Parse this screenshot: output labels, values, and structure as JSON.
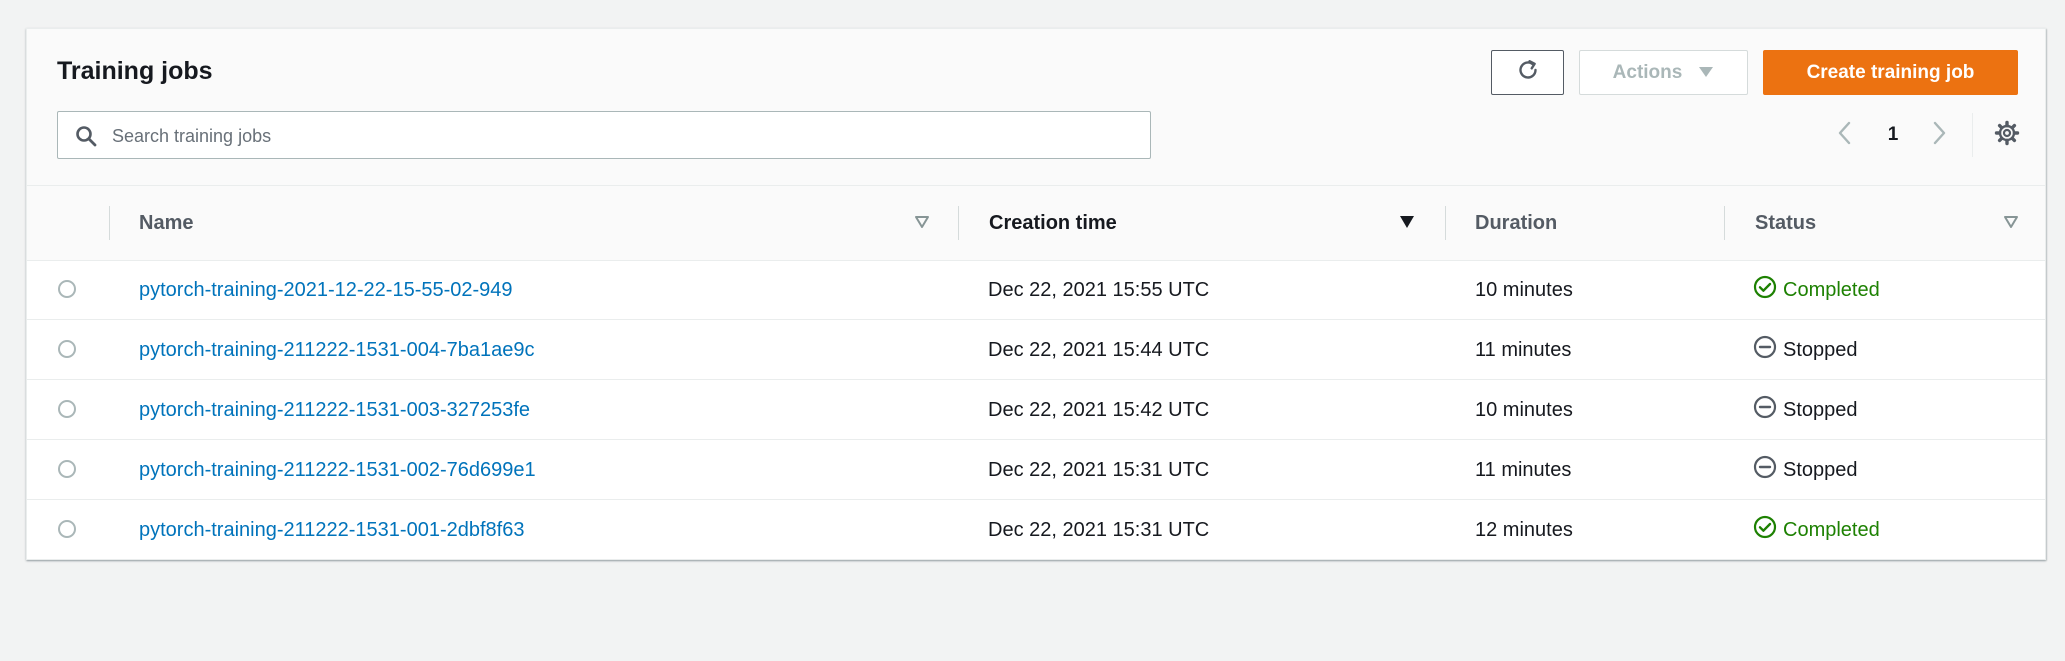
{
  "panel": {
    "title": "Training jobs",
    "search": {
      "placeholder": "Search training jobs",
      "value": ""
    },
    "toolbar": {
      "refresh_icon": "refresh-icon",
      "actions_label": "Actions",
      "create_label": "Create training job"
    },
    "pagination": {
      "current_page": "1"
    }
  },
  "table": {
    "columns": [
      {
        "label": "Name",
        "sort": "sortable"
      },
      {
        "label": "Creation time",
        "sort": "descending"
      },
      {
        "label": "Duration",
        "sort": "none"
      },
      {
        "label": "Status",
        "sort": "sortable"
      }
    ],
    "rows": [
      {
        "name": "pytorch-training-2021-12-22-15-55-02-949",
        "creation_time": "Dec 22, 2021 15:55 UTC",
        "duration": "10 minutes",
        "status": "Completed",
        "status_type": "completed"
      },
      {
        "name": "pytorch-training-211222-1531-004-7ba1ae9c",
        "creation_time": "Dec 22, 2021 15:44 UTC",
        "duration": "11 minutes",
        "status": "Stopped",
        "status_type": "stopped"
      },
      {
        "name": "pytorch-training-211222-1531-003-327253fe",
        "creation_time": "Dec 22, 2021 15:42 UTC",
        "duration": "10 minutes",
        "status": "Stopped",
        "status_type": "stopped"
      },
      {
        "name": "pytorch-training-211222-1531-002-76d699e1",
        "creation_time": "Dec 22, 2021 15:31 UTC",
        "duration": "11 minutes",
        "status": "Stopped",
        "status_type": "stopped"
      },
      {
        "name": "pytorch-training-211222-1531-001-2dbf8f63",
        "creation_time": "Dec 22, 2021 15:31 UTC",
        "duration": "12 minutes",
        "status": "Completed",
        "status_type": "completed"
      }
    ]
  },
  "colors": {
    "accent": "#ec7211",
    "link": "#0073bb",
    "success": "#1d8102",
    "muted": "#545b64"
  }
}
